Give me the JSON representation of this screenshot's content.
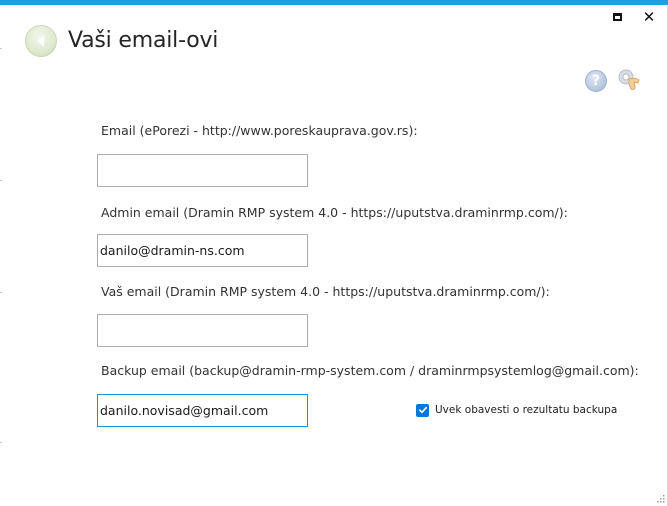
{
  "window": {
    "maximize_icon": "maximize-icon",
    "close_icon": "close-icon",
    "close_glyph": "✕",
    "accent_color": "#1ba1e2"
  },
  "header": {
    "back_icon": "back-arrow-icon",
    "title": "Vaši email-ovi",
    "help_icon": "help-icon",
    "help_glyph": "?",
    "settings_icon": "settings-hand-icon"
  },
  "form": {
    "fields": [
      {
        "label": "Email (ePorezi - http://www.poreskauprava.gov.rs):",
        "value": "",
        "placeholder": ""
      },
      {
        "label": "Admin email (Dramin RMP system 4.0 - https://uputstva.draminrmp.com/):",
        "value": "danilo@dramin-ns.com",
        "placeholder": ""
      },
      {
        "label": "Vaš email (Dramin RMP system 4.0 - https://uputstva.draminrmp.com/):",
        "value": "",
        "placeholder": ""
      },
      {
        "label": "Backup email (backup@dramin-rmp-system.com / draminrmpsystemlog@gmail.com):",
        "value": "danilo.novisad@gmail.com",
        "placeholder": ""
      }
    ],
    "notify_checkbox": {
      "label": "Uvek obavesti o rezultatu  backupa",
      "checked": true,
      "color": "#0b78d7"
    }
  }
}
